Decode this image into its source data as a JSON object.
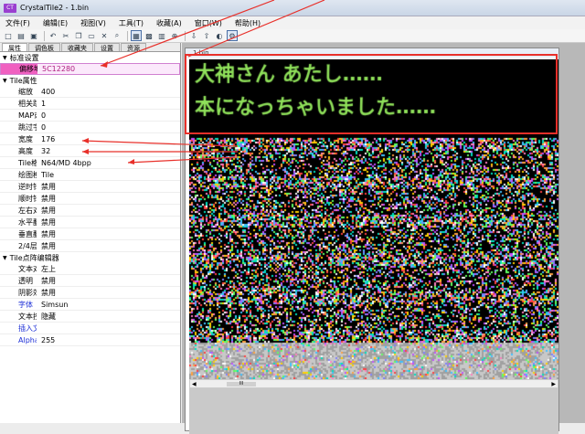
{
  "window": {
    "title": "CrystalTile2 - 1.bin",
    "app_icon": "CT"
  },
  "menu": [
    "文件(F)",
    "编辑(E)",
    "视图(V)",
    "工具(T)",
    "收藏(A)",
    "窗口(W)",
    "帮助(H)"
  ],
  "toolbar": [
    "new-file-icon",
    "open-folder-icon",
    "save-icon",
    "undo-icon",
    "cut-icon",
    "copy-icon",
    "paste-icon",
    "delete-icon",
    "search-icon",
    "grid-view-icon",
    "tile-view-icon",
    "map-view-icon",
    "zoom-icon",
    "import-icon",
    "export-icon",
    "palette-icon",
    "settings-icon"
  ],
  "tabs": [
    "属性",
    "调色板",
    "收藏夹",
    "设置",
    "资源"
  ],
  "sections": {
    "standard": "标准设置",
    "tile": "Tile属性",
    "editor": "Tile点阵编辑器"
  },
  "props_standard": [
    {
      "name": "偏移地址",
      "value": "5C12280"
    }
  ],
  "props_tile": [
    {
      "name": "缩放",
      "value": "400"
    },
    {
      "name": "相关跳转",
      "value": "1"
    },
    {
      "name": "MAP或自",
      "value": "0"
    },
    {
      "name": "跳过字节",
      "value": "0"
    },
    {
      "name": "宽度",
      "value": "176"
    },
    {
      "name": "高度",
      "value": "32"
    },
    {
      "name": "Tile格式",
      "value": "N64/MD 4bpp"
    },
    {
      "name": "绘图模式",
      "value": "Tile"
    },
    {
      "name": "逆时针",
      "value": "禁用"
    },
    {
      "name": "顺时针",
      "value": "禁用"
    },
    {
      "name": "左右对调",
      "value": "禁用"
    },
    {
      "name": "水平翻转",
      "value": "禁用"
    },
    {
      "name": "垂直翻转",
      "value": "禁用"
    },
    {
      "name": "2/4层",
      "value": "禁用"
    }
  ],
  "props_editor": [
    {
      "name": "文本对齐",
      "value": "左上",
      "blue": false
    },
    {
      "name": "透明",
      "value": "禁用",
      "blue": false
    },
    {
      "name": "阴影效果",
      "value": "禁用",
      "blue": false
    },
    {
      "name": "字体",
      "value": "Simsun",
      "blue": true
    },
    {
      "name": "文本控制",
      "value": "隐藏",
      "blue": false
    },
    {
      "name": "插入文本",
      "value": "",
      "blue": true
    },
    {
      "name": "Alpha通道",
      "value": "255",
      "blue": true
    }
  ],
  "document": {
    "title": "1.bin",
    "text_line1": "大神さん あたし……",
    "text_line2": "本になっちゃいました……",
    "scroll_thumb": "III"
  },
  "colors": {
    "annotation_red": "#e8302a",
    "text_green": "#8fe05a",
    "highlight_pink": "#f060c0"
  }
}
